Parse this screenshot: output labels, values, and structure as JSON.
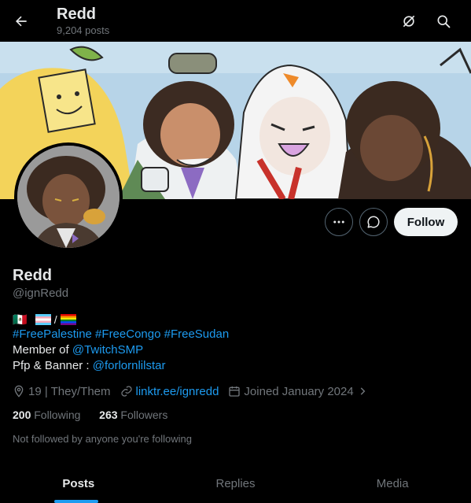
{
  "header": {
    "title": "Redd",
    "post_count": "9,204 posts"
  },
  "actions": {
    "follow_label": "Follow"
  },
  "profile": {
    "name": "Redd",
    "handle": "@ignRedd",
    "flags": {
      "mexico": "🇲🇽",
      "separator": "/"
    },
    "bio": {
      "hashtags": "#FreePalestine #FreeCongo #FreeSudan",
      "member_prefix": "Member of ",
      "member_link": "@TwitchSMP",
      "pfp_prefix": "Pfp & Banner : ",
      "pfp_link": "@forlornlilstar"
    },
    "location": "19 | They/Them",
    "website": "linktr.ee/ignredd",
    "joined": "Joined January 2024",
    "following_count": "200",
    "following_label": "Following",
    "followers_count": "263",
    "followers_label": "Followers",
    "followed_by_note": "Not followed by anyone you're following"
  },
  "tabs": [
    "Posts",
    "Replies",
    "Media"
  ],
  "colors": {
    "accent": "#1d9bf0",
    "background": "#000000",
    "muted": "#71767b"
  },
  "icons": [
    "back-arrow-icon",
    "grok-icon",
    "search-icon",
    "more-icon",
    "message-icon",
    "location-icon",
    "link-icon",
    "calendar-icon",
    "chevron-right-icon"
  ]
}
